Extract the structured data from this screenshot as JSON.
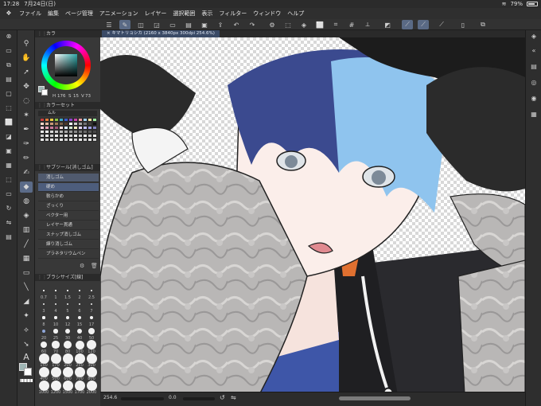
{
  "status": {
    "time": "17:28",
    "date": "7月24日(日)",
    "battery_pct": "79%",
    "battery_level": 0.79
  },
  "menu": [
    "ファイル",
    "編集",
    "ページ管理",
    "アニメーション",
    "レイヤー",
    "選択範囲",
    "表示",
    "フィルター",
    "ウィンドウ",
    "ヘルプ"
  ],
  "document": {
    "tab_title": "キマトリョシカ (2160 x 3840px 300dpi 254.6%)"
  },
  "palettes": {
    "color_wheel_title": "カラ",
    "hsv": {
      "h": "176",
      "s": "15",
      "v": "73"
    },
    "color_set_title": "カラーセット",
    "color_set_name": "ムル",
    "sub_tool_title": "サブツール[消しゴム]",
    "brush_size_title": "ブラシサイズ[線]"
  },
  "sub_tools": [
    "消しゴム",
    "硬め",
    "軟らかめ",
    "ざっくり",
    "ベクター用",
    "レイヤー貫通",
    "スナップ消しゴム",
    "練り消しゴム",
    "プラネタリウムペン"
  ],
  "brush_sizes": [
    "0.7",
    "1",
    "1.5",
    "2",
    "2.5",
    "3",
    "4",
    "5",
    "6",
    "7",
    "8",
    "10",
    "12",
    "15",
    "17",
    "20",
    "25",
    "30",
    "40",
    "50",
    "60",
    "70",
    "80",
    "100",
    "120",
    "150",
    "170",
    "200",
    "250",
    "300",
    "400",
    "500",
    "600",
    "700",
    "800",
    "1000",
    "1200",
    "1500",
    "1700",
    "2000"
  ],
  "bottom": {
    "zoom": "254.6",
    "rotation": "0.0"
  }
}
